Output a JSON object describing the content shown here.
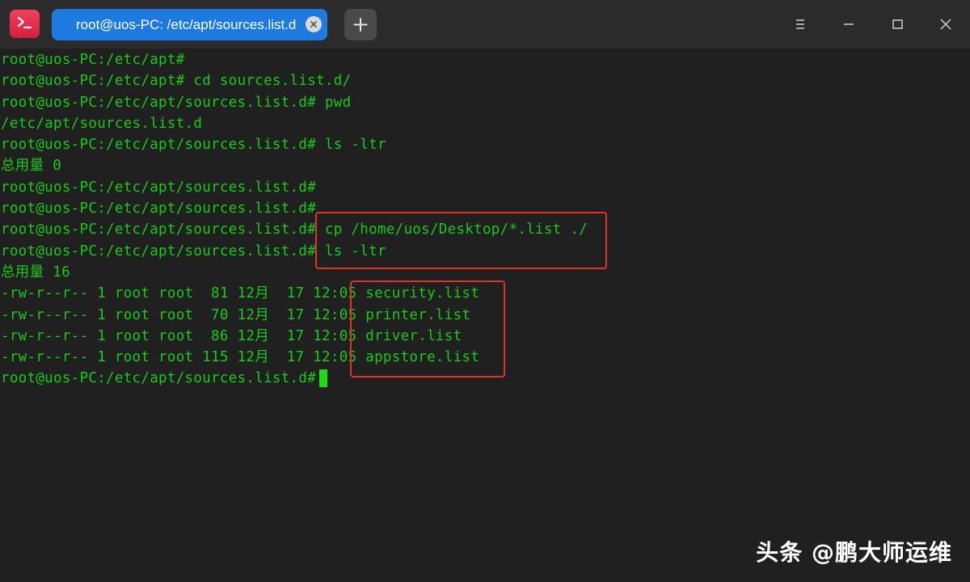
{
  "titlebar": {
    "app_icon": "terminal-app-icon",
    "tab_title": "root@uos-PC: /etc/apt/sources.list.d",
    "tab_close_icon": "close-icon",
    "new_tab_icon": "plus-icon",
    "menu_icon": "hamburger-menu-icon",
    "minimize_icon": "minimize-icon",
    "maximize_icon": "maximize-icon",
    "close_icon": "close-icon"
  },
  "colors": {
    "background": "#202020",
    "titlebar": "#2b2b2b",
    "tab_active": "#1f7ae0",
    "text": "#18c918",
    "highlight_box": "#e0322b"
  },
  "terminal": {
    "lines": [
      {
        "prompt": "root@uos-PC:/etc/apt#",
        "cmd": ""
      },
      {
        "prompt": "root@uos-PC:/etc/apt#",
        "cmd": " cd sources.list.d/"
      },
      {
        "prompt": "root@uos-PC:/etc/apt/sources.list.d#",
        "cmd": " pwd"
      },
      {
        "prompt": "/etc/apt/sources.list.d",
        "cmd": ""
      },
      {
        "prompt": "root@uos-PC:/etc/apt/sources.list.d#",
        "cmd": " ls -ltr"
      },
      {
        "prompt": "总用量 0",
        "cmd": ""
      },
      {
        "prompt": "root@uos-PC:/etc/apt/sources.list.d#",
        "cmd": ""
      },
      {
        "prompt": "root@uos-PC:/etc/apt/sources.list.d#",
        "cmd": ""
      },
      {
        "prompt": "root@uos-PC:/etc/apt/sources.list.d#",
        "cmd": " cp /home/uos/Desktop/*.list ./"
      },
      {
        "prompt": "root@uos-PC:/etc/apt/sources.list.d#",
        "cmd": " ls -ltr"
      },
      {
        "prompt": "总用量 16",
        "cmd": ""
      },
      {
        "prompt": "-rw-r--r-- 1 root root  81 12月  17 12:05",
        "cmd": " security.list"
      },
      {
        "prompt": "-rw-r--r-- 1 root root  70 12月  17 12:05",
        "cmd": " printer.list"
      },
      {
        "prompt": "-rw-r--r-- 1 root root  86 12月  17 12:05",
        "cmd": " driver.list"
      },
      {
        "prompt": "-rw-r--r-- 1 root root 115 12月  17 12:05",
        "cmd": " appstore.list"
      },
      {
        "prompt": "root@uos-PC:/etc/apt/sources.list.d#",
        "cmd": ""
      }
    ]
  },
  "watermark": "头条 @鹏大师运维"
}
